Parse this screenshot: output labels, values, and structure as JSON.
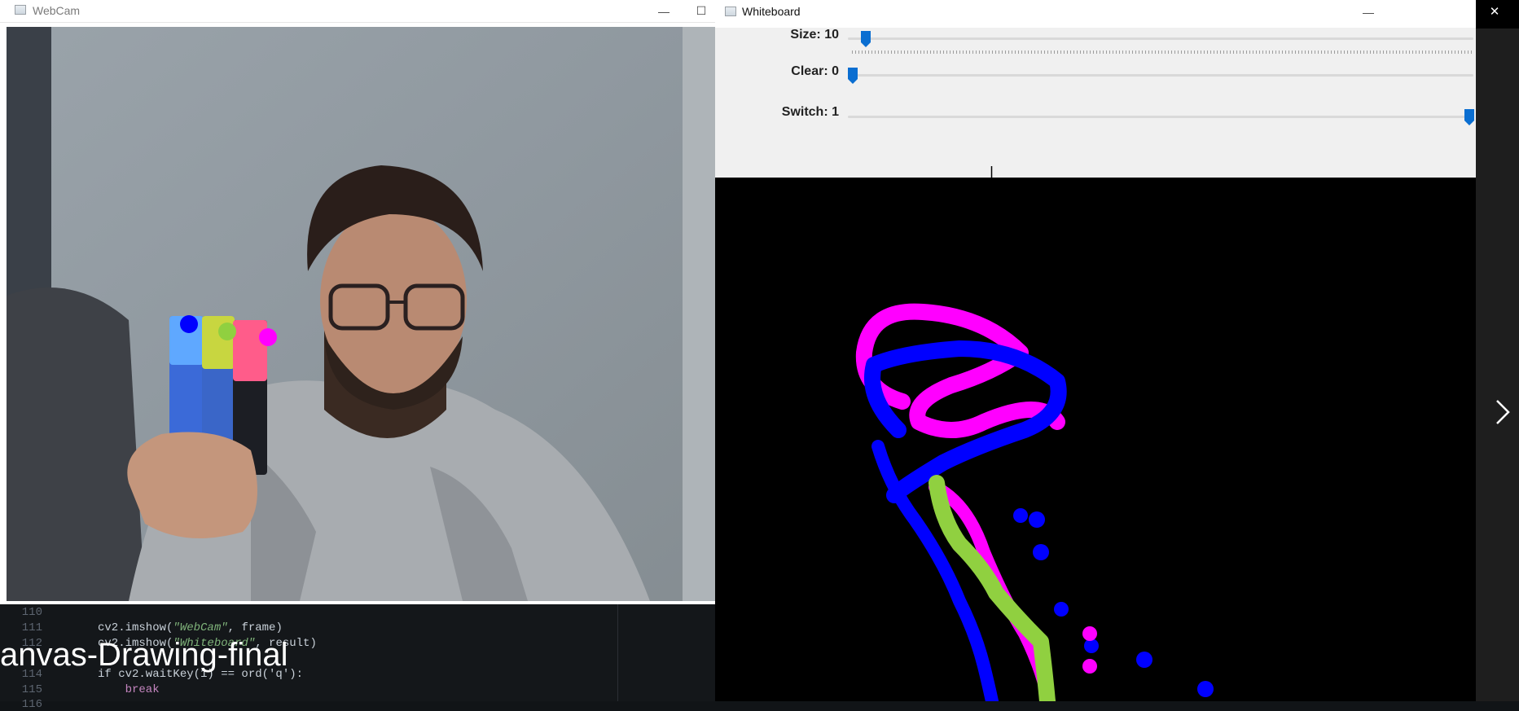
{
  "webcam": {
    "title": "WebCam",
    "minimize": "—",
    "maximize": "☐"
  },
  "whiteboard": {
    "title": "Whiteboard",
    "minimize": "—",
    "trackbars": [
      {
        "label": "Size: 10",
        "value": 10
      },
      {
        "label": "Clear: 0",
        "value": 0
      },
      {
        "label": "Switch: 1",
        "value": 1
      }
    ]
  },
  "system_buttons": {
    "minimize": "—",
    "restore": "❐",
    "close": "✕"
  },
  "editor": {
    "lines": [
      {
        "num": "110",
        "code": ""
      },
      {
        "num": "111",
        "code_prefix": "cv2.imshow(",
        "code_str": "\"WebCam\"",
        "code_suffix": ", frame)"
      },
      {
        "num": "112",
        "code_prefix": "cv2.imshow(",
        "code_str": "\"Whiteboard\"",
        "code_suffix": ", result)"
      },
      {
        "num": "114",
        "code": "if cv2.waitKey(1) == ord('q'):"
      },
      {
        "num": "115",
        "code": "    break"
      },
      {
        "num": "116",
        "code": ""
      }
    ]
  },
  "overlay_title": "anvas-Drawing-final",
  "colors": {
    "marker_blue": "#0000ff",
    "marker_green": "#90d040",
    "marker_magenta": "#ff00ff",
    "slider_thumb": "#0a6ed1"
  }
}
